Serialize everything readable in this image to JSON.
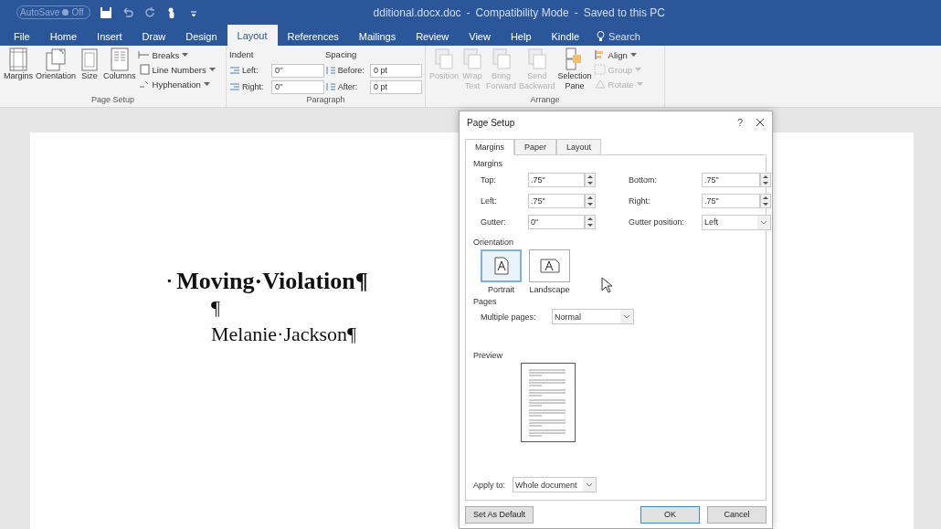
{
  "title_bar": {
    "autosave": {
      "label": "AutoSave",
      "state": "Off",
      "on": false
    },
    "title_parts": [
      "dditional.docx.doc",
      "-",
      "Compatibility Mode",
      "-",
      "Saved to this PC"
    ]
  },
  "tabs": [
    {
      "label": "File",
      "selected": false
    },
    {
      "label": "Home",
      "selected": false
    },
    {
      "label": "Insert",
      "selected": false
    },
    {
      "label": "Draw",
      "selected": false
    },
    {
      "label": "Design",
      "selected": false
    },
    {
      "label": "Layout",
      "selected": true
    },
    {
      "label": "References",
      "selected": false
    },
    {
      "label": "Mailings",
      "selected": false
    },
    {
      "label": "Review",
      "selected": false
    },
    {
      "label": "View",
      "selected": false
    },
    {
      "label": "Help",
      "selected": false
    },
    {
      "label": "Kindle",
      "selected": false
    }
  ],
  "search": {
    "label": "Search"
  },
  "ribbon": {
    "page_setup": {
      "label": "Page Setup",
      "large": [
        {
          "lines": [
            "Margins"
          ],
          "disabled": false
        },
        {
          "lines": [
            "Orientation"
          ],
          "disabled": false
        },
        {
          "lines": [
            "Size"
          ],
          "disabled": false
        },
        {
          "lines": [
            "Columns"
          ],
          "disabled": false
        }
      ],
      "small": [
        {
          "label": "Breaks",
          "disabled": false
        },
        {
          "label": "Line Numbers",
          "disabled": false
        },
        {
          "label": "Hyphenation",
          "disabled": false
        }
      ]
    },
    "paragraph": {
      "label": "Paragraph",
      "indent_label": "Indent",
      "spacing_label": "Spacing",
      "indent": [
        {
          "label": "Left:",
          "value": "0\""
        },
        {
          "label": "Right:",
          "value": "0\""
        }
      ],
      "spacing": [
        {
          "label": "Before:",
          "value": "0 pt"
        },
        {
          "label": "After:",
          "value": "0 pt"
        }
      ]
    },
    "arrange": {
      "label": "Arrange",
      "large": [
        {
          "lines": [
            "Position"
          ],
          "disabled": true
        },
        {
          "lines": [
            "Wrap",
            "Text"
          ],
          "disabled": true
        },
        {
          "lines": [
            "Bring",
            "Forward"
          ],
          "disabled": true
        },
        {
          "lines": [
            "Send",
            "Backward"
          ],
          "disabled": true
        },
        {
          "lines": [
            "Selection",
            "Pane"
          ],
          "disabled": false
        }
      ],
      "small": [
        {
          "label": "Align",
          "disabled": false
        },
        {
          "label": "Group",
          "disabled": true
        },
        {
          "label": "Rotate",
          "disabled": true
        }
      ]
    }
  },
  "document": {
    "paragraphs": [
      {
        "kind": "heading",
        "mark": "▪",
        "text": "Moving·Violation¶"
      },
      {
        "kind": "body",
        "text": "¶"
      },
      {
        "kind": "body",
        "text": "Melanie·Jackson¶"
      }
    ]
  },
  "dialog": {
    "title": "Page Setup",
    "help": "?",
    "tabs": [
      {
        "label": "Margins",
        "selected": true
      },
      {
        "label": "Paper",
        "selected": false
      },
      {
        "label": "Layout",
        "selected": false
      }
    ],
    "margins_label": "Margins",
    "margin_fields": [
      {
        "kind": "spin",
        "label": "Top:",
        "value": ".75\""
      },
      {
        "kind": "spin",
        "label": "Bottom:",
        "value": ".75\""
      },
      {
        "kind": "spin",
        "label": "Left:",
        "value": ".75\""
      },
      {
        "kind": "spin",
        "label": "Right:",
        "value": ".75\""
      },
      {
        "kind": "spin",
        "label": "Gutter:",
        "value": "0\""
      },
      {
        "kind": "select",
        "label": "Gutter position:",
        "value": "Left"
      }
    ],
    "orientation_label": "Orientation",
    "orientations": [
      {
        "label": "Portrait",
        "kind": "portrait",
        "selected": true
      },
      {
        "label": "Landscape",
        "kind": "landscape",
        "selected": false
      }
    ],
    "pages_label": "Pages",
    "multiple_pages": {
      "label": "Multiple pages:",
      "value": "Normal"
    },
    "preview_label": "Preview",
    "apply_to": {
      "label": "Apply to:",
      "value": "Whole document"
    },
    "buttons": [
      {
        "label": "Set As Default",
        "default": false
      },
      {
        "label": "OK",
        "default": true
      },
      {
        "label": "Cancel",
        "default": false
      }
    ]
  }
}
